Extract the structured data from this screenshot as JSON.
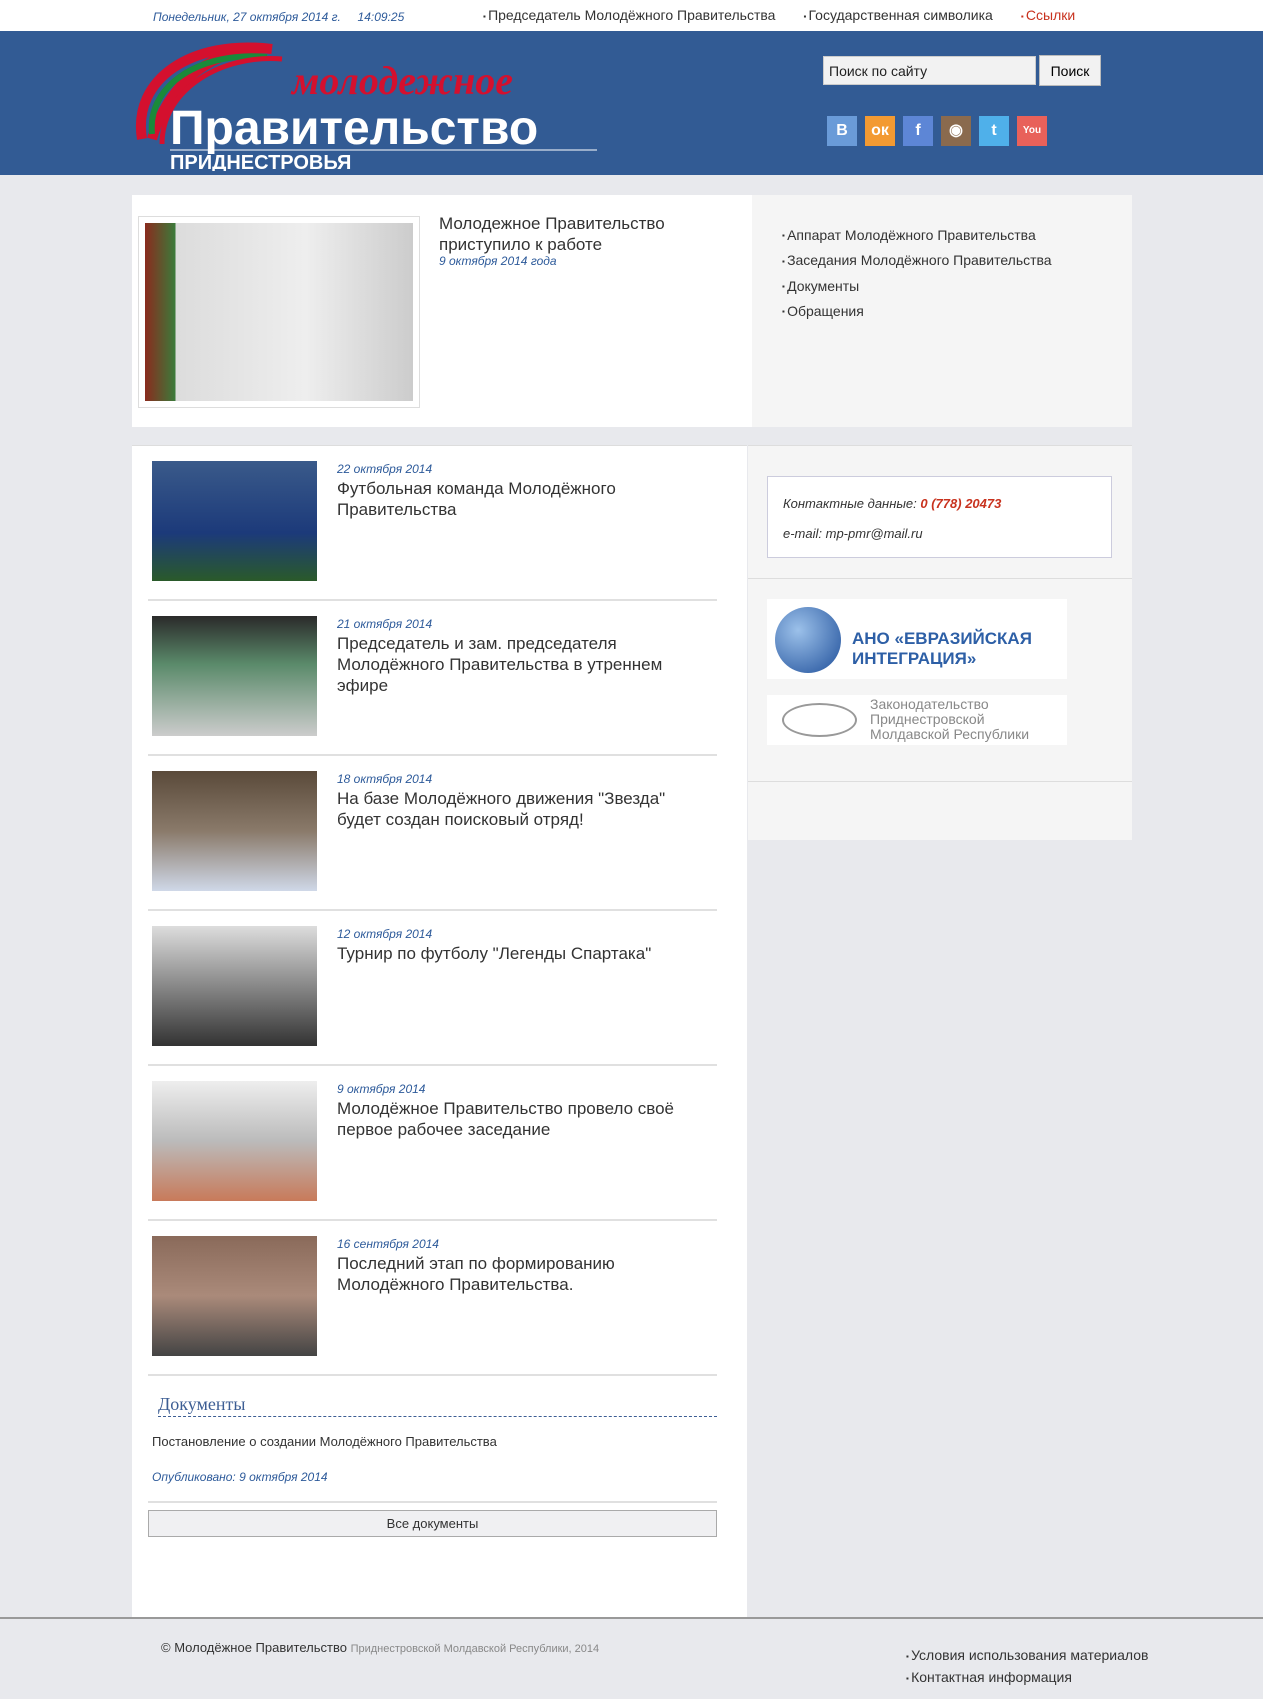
{
  "topbar": {
    "date": "Понедельник, 27 октября 2014 г.",
    "time": "14:09:25",
    "links": [
      "Председатель Молодёжного Правительства",
      "Государственная символика",
      "Ссылки"
    ]
  },
  "header": {
    "logo_line1": "молодежное",
    "logo_line2": "Правительство",
    "logo_line3": "ПРИДНЕСТРОВЬЯ",
    "search_value": "Поиск по сайту",
    "search_button": "Поиск",
    "social": [
      {
        "icon": "vk-icon",
        "glyph": "B",
        "color": "#6a9bd8"
      },
      {
        "icon": "odnoklassniki-icon",
        "glyph": "ок",
        "color": "#f39a32"
      },
      {
        "icon": "facebook-icon",
        "glyph": "f",
        "color": "#5d86d6"
      },
      {
        "icon": "instagram-icon",
        "glyph": "◉",
        "color": "#8a6a4e"
      },
      {
        "icon": "twitter-icon",
        "glyph": "t",
        "color": "#4fb0ea"
      },
      {
        "icon": "youtube-icon",
        "glyph": "You",
        "color": "#e8615a"
      }
    ]
  },
  "featured": {
    "title": "Молодежное Правительство приступило к работе",
    "date": "9 октября 2014 года"
  },
  "menu": [
    "Аппарат Молодёжного Правительства",
    "Заседания Молодёжного Правительства",
    "Документы",
    "Обращения"
  ],
  "news": [
    {
      "date": "22 октября 2014",
      "title": "Футбольная команда Молодёжного Правительства"
    },
    {
      "date": "21 октября 2014",
      "title": "Председатель и зам. председателя Молодёжного Правительства в утреннем эфире"
    },
    {
      "date": "18 октября 2014",
      "title": "На базе Молодёжного движения \"Звезда\" будет создан поисковый отряд!"
    },
    {
      "date": "12 октября 2014",
      "title": "Турнир по футболу \"Легенды Спартака\""
    },
    {
      "date": "9 октября 2014",
      "title": "Молодёжное Правительство провело своё первое рабочее заседание"
    },
    {
      "date": "16 сентября 2014",
      "title": "Последний этап по формированию Молодёжного Правительства."
    }
  ],
  "documents": {
    "heading": "Документы",
    "item": "Постановление о создании Молодёжного Правительства",
    "published": "Опубликовано: 9 октября 2014",
    "all_button": "Все документы"
  },
  "contact": {
    "label": "Контактные данные:",
    "phone": "0 (778) 20473",
    "email": "e-mail: mp-pmr@mail.ru"
  },
  "banners": {
    "b1": "АНО «ЕВРАЗИЙСКАЯ ИНТЕГРАЦИЯ»",
    "b2": "Законодательство Приднестровской Молдавской Республики"
  },
  "footer": {
    "copy_main": "© Молодёжное Правительство",
    "copy_rest": "Приднестровской Молдавской Республики, 2014",
    "links": [
      "Условия использования материалов",
      "Контактная информация"
    ]
  }
}
